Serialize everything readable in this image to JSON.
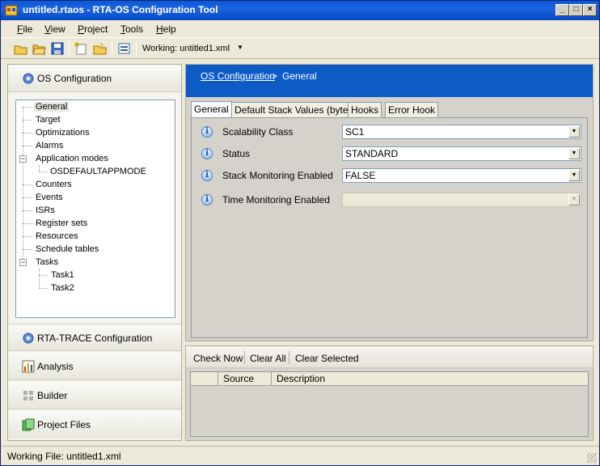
{
  "window": {
    "title": "untitled.rtaos - RTA-OS Configuration Tool"
  },
  "menu": [
    {
      "underline": "F",
      "rest": "ile"
    },
    {
      "underline": "V",
      "rest": "iew"
    },
    {
      "underline": "P",
      "rest": "roject"
    },
    {
      "underline": "T",
      "rest": "ools"
    },
    {
      "underline": "H",
      "rest": "elp"
    }
  ],
  "toolbar": {
    "working_label": "Working: untitled1.xml"
  },
  "left": {
    "sections": {
      "os": "OS Configuration",
      "trace": "RTA-TRACE Configuration",
      "analysis": "Analysis",
      "builder": "Builder",
      "files": "Project Files"
    },
    "tree": [
      "General",
      "Target",
      "Optimizations",
      "Alarms",
      "Application modes",
      "OSDEFAULTAPPMODE",
      "Counters",
      "Events",
      "ISRs",
      "Register sets",
      "Resources",
      "Schedule tables",
      "Tasks",
      "Task1",
      "Task2"
    ]
  },
  "breadcrumb": {
    "link": "OS Configuration",
    "sep": ">",
    "current": "General"
  },
  "tabs": [
    "General",
    "Default Stack Values (bytes)",
    "Hooks",
    "Error Hook"
  ],
  "properties": [
    {
      "label": "Scalability Class",
      "value": "SC1"
    },
    {
      "label": "Status",
      "value": "STANDARD"
    },
    {
      "label": "Stack Monitoring Enabled",
      "value": "FALSE"
    },
    {
      "label": "Time Monitoring Enabled",
      "value": ""
    }
  ],
  "messages": {
    "buttons": [
      "Check Now",
      "Clear All",
      "Clear Selected"
    ],
    "columns": [
      "",
      "Source",
      "Description"
    ]
  },
  "status": {
    "text": "Working File:  untitled1.xml"
  },
  "colors": {
    "header": "#0d5cc6",
    "titlebar": "#0a58d8"
  }
}
